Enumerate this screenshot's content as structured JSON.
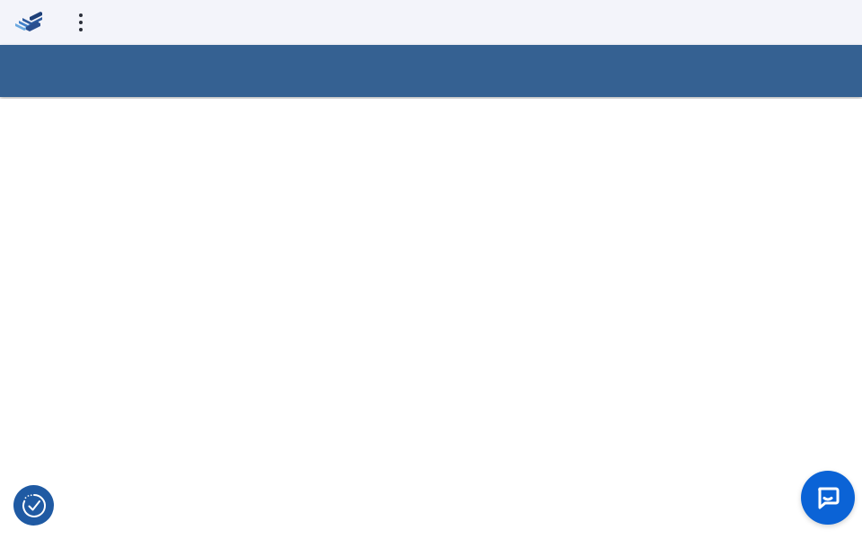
{
  "header": {
    "logo_icon": "stacked-chevrons-logo-icon",
    "menu_icon": "kebab-vertical-icon",
    "background_color": "#f3f4fa"
  },
  "banner": {
    "background_color": "#356192"
  },
  "widgets": {
    "cookie_consent_icon": "clock-check-icon",
    "chat_icon": "chat-bubble-icon",
    "cookie_color": "#1f5aa3",
    "chat_color": "#0b63d6"
  }
}
